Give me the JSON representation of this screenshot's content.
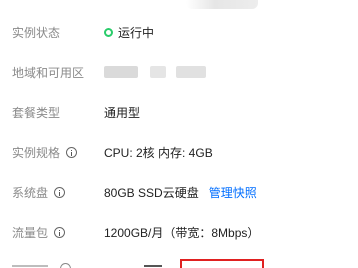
{
  "instance_info": {
    "status": {
      "label": "实例状态",
      "value": "运行中",
      "status_color": "#29cc6a"
    },
    "region": {
      "label": "地域和可用区",
      "value_visible": "",
      "redacted": true
    },
    "package_type": {
      "label": "套餐类型",
      "value": "通用型"
    },
    "spec": {
      "label": "实例规格",
      "icon": "help-circle-icon",
      "value": "CPU: 2核 内存: 4GB"
    },
    "system_disk": {
      "label": "系统盘",
      "icon": "help-circle-icon",
      "value": "80GB SSD云硬盘",
      "link": "管理快照"
    },
    "traffic": {
      "label": "流量包",
      "icon": "help-circle-icon",
      "value": "1200GB/月（带宽：8Mbps）"
    }
  },
  "colors": {
    "label": "#8a8a8a",
    "value": "#222222",
    "link": "#006eff",
    "highlight_box": "#e02020"
  }
}
